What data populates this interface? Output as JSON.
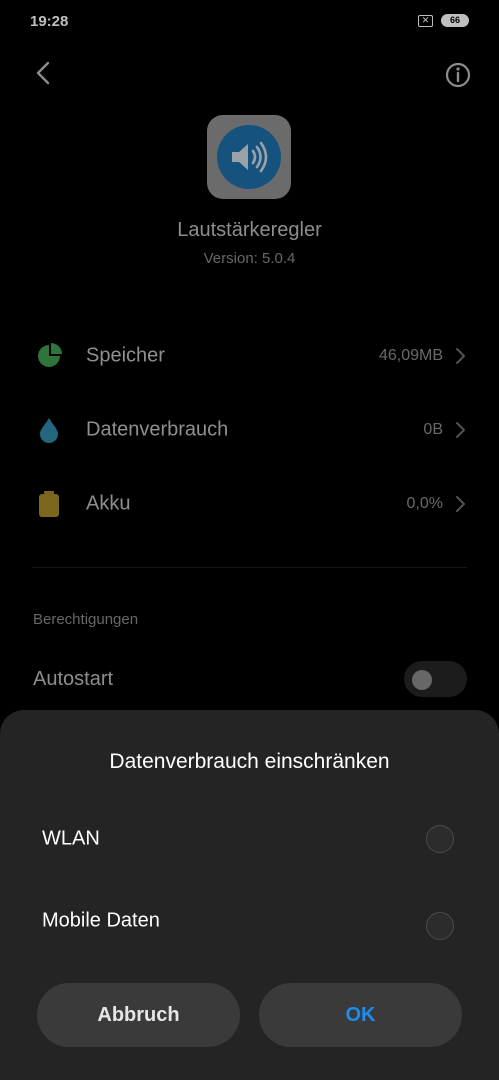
{
  "status_bar": {
    "time": "19:28",
    "sim_glyph": "✕",
    "battery_level": "66"
  },
  "app": {
    "name": "Lautstärkeregler",
    "version": "Version: 5.0.4"
  },
  "usage_rows": [
    {
      "icon": "pie-chart-icon",
      "label": "Speicher",
      "value": "46,09MB",
      "color": "#3e9b4f"
    },
    {
      "icon": "water-drop-icon",
      "label": "Datenverbrauch",
      "value": "0B",
      "color": "#2e8aa8"
    },
    {
      "icon": "battery-icon",
      "label": "Akku",
      "value": "0,0%",
      "color": "#a58a25"
    }
  ],
  "permissions": {
    "header": "Berechtigungen",
    "autostart_label": "Autostart"
  },
  "dialog": {
    "title": "Datenverbrauch einschränken",
    "options": [
      {
        "label": "WLAN"
      },
      {
        "label": "Mobile Daten"
      }
    ],
    "cancel_label": "Abbruch",
    "ok_label": "OK"
  },
  "colors": {
    "accent": "#1d8cf0",
    "sheet_bg": "#242424"
  }
}
